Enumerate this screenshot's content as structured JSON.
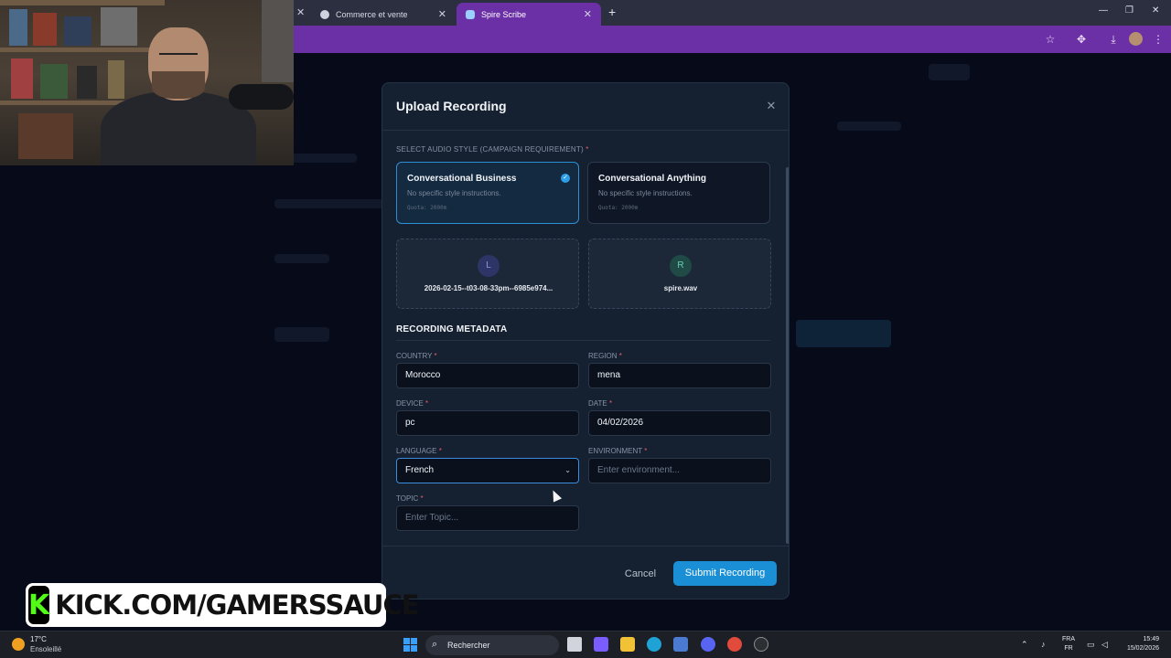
{
  "browser": {
    "tabs": [
      {
        "label": "Commerce et vente",
        "active": false
      },
      {
        "label": "Spire Scribe",
        "active": true
      }
    ],
    "toolbar_color": "#6b2fa6"
  },
  "modal": {
    "title": "Upload Recording",
    "audio_style": {
      "label": "SELECT AUDIO STYLE (CAMPAIGN REQUIREMENT)",
      "required_mark": "*",
      "options": [
        {
          "title": "Conversational Business",
          "description": "No specific style instructions.",
          "quota": "Quota: 2000m",
          "selected": true
        },
        {
          "title": "Conversational Anything",
          "description": "No specific style instructions.",
          "quota": "Quota: 2000m",
          "selected": false
        }
      ]
    },
    "files": [
      {
        "initial": "L",
        "name": "2026-02-15--t03-08-33pm--6985e974..."
      },
      {
        "initial": "R",
        "name": "spire.wav"
      }
    ],
    "metadata_heading": "RECORDING METADATA",
    "fields": {
      "country": {
        "label": "COUNTRY",
        "value": "Morocco"
      },
      "region": {
        "label": "REGION",
        "value": "mena"
      },
      "device": {
        "label": "DEVICE",
        "value": "pc"
      },
      "date": {
        "label": "DATE",
        "value": "04/02/2026"
      },
      "language": {
        "label": "LANGUAGE",
        "value": "French"
      },
      "environment": {
        "label": "ENVIRONMENT",
        "value": "",
        "placeholder": "Enter environment..."
      },
      "topic": {
        "label": "TOPIC",
        "value": "",
        "placeholder": "Enter Topic..."
      }
    },
    "cancel_label": "Cancel",
    "submit_label": "Submit Recording",
    "accent_color": "#1a8fd6"
  },
  "overlay": {
    "kick_logo": "K",
    "kick_text": "KICK.COM/GAMERSSAUCE"
  },
  "taskbar": {
    "weather_temp": "17°C",
    "weather_desc": "Ensoleillé",
    "search_label": "Rechercher",
    "lang_top": "FRA",
    "lang_bottom": "FR",
    "time": "15:49",
    "date": "15/02/2026"
  }
}
